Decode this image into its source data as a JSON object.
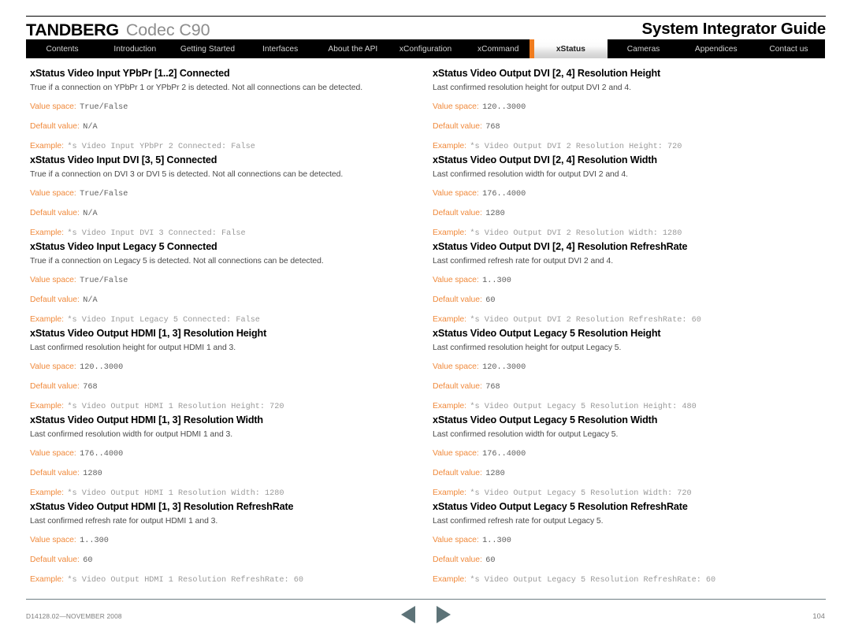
{
  "header": {
    "brand": "TANDBERG",
    "product": "Codec C90",
    "guide_title": "System Integrator Guide"
  },
  "nav": {
    "items": [
      {
        "label": "Contents",
        "active": false
      },
      {
        "label": "Introduction",
        "active": false
      },
      {
        "label": "Getting Started",
        "active": false
      },
      {
        "label": "Interfaces",
        "active": false
      },
      {
        "label": "About the API",
        "active": false
      },
      {
        "label": "xConfiguration",
        "active": false
      },
      {
        "label": "xCommand",
        "active": false
      },
      {
        "label": "xStatus",
        "active": true
      },
      {
        "label": "Cameras",
        "active": false
      },
      {
        "label": "Appendices",
        "active": false
      },
      {
        "label": "Contact us",
        "active": false
      }
    ],
    "active_accent_color": "#f07c1e"
  },
  "labels": {
    "value_space": "Value space:",
    "default_value": "Default value:",
    "example": "Example:"
  },
  "left_column": [
    {
      "title": "xStatus Video Input YPbPr [1..2] Connected",
      "description": "True if a connection on YPbPr 1 or YPbPr 2 is detected. Not all connections can be detected.",
      "value_space": "True/False",
      "default_value": "N/A",
      "example": "*s Video Input YPbPr 2 Connected: False"
    },
    {
      "title": "xStatus Video Input DVI [3, 5] Connected",
      "description": "True if a connection on DVI 3 or DVI 5 is detected. Not all connections can be detected.",
      "value_space": "True/False",
      "default_value": "N/A",
      "example": "*s Video Input DVI 3 Connected: False"
    },
    {
      "title": "xStatus Video Input Legacy 5 Connected",
      "description": "True if a connection on Legacy 5 is detected. Not all connections can be detected.",
      "value_space": "True/False",
      "default_value": "N/A",
      "example": "*s Video Input Legacy 5 Connected: False"
    },
    {
      "title": "xStatus Video Output HDMI [1, 3] Resolution Height",
      "description": "Last confirmed resolution height for output HDMI 1 and 3.",
      "value_space": "120..3000",
      "default_value": "768",
      "example": "*s Video Output HDMI 1 Resolution Height: 720"
    },
    {
      "title": "xStatus Video Output HDMI [1, 3] Resolution Width",
      "description": "Last confirmed resolution width for output HDMI 1 and 3.",
      "value_space": "176..4000",
      "default_value": "1280",
      "example": "*s Video Output HDMI 1 Resolution Width: 1280"
    },
    {
      "title": "xStatus Video Output HDMI [1, 3] Resolution RefreshRate",
      "description": "Last confirmed refresh rate for output HDMI 1 and 3.",
      "value_space": "1..300",
      "default_value": "60",
      "example": "*s Video Output HDMI 1 Resolution RefreshRate: 60"
    }
  ],
  "right_column": [
    {
      "title": "xStatus Video Output DVI [2, 4] Resolution Height",
      "description": "Last confirmed resolution height for output DVI 2 and 4.",
      "value_space": "120..3000",
      "default_value": "768",
      "example": "*s Video Output DVI 2 Resolution Height: 720"
    },
    {
      "title": "xStatus Video Output DVI [2, 4] Resolution Width",
      "description": "Last confirmed resolution width for output DVI 2 and 4.",
      "value_space": "176..4000",
      "default_value": "1280",
      "example": "*s Video Output DVI 2 Resolution Width: 1280"
    },
    {
      "title": "xStatus Video Output DVI [2, 4] Resolution RefreshRate",
      "description": "Last confirmed refresh rate for output DVI 2 and 4.",
      "value_space": "1..300",
      "default_value": "60",
      "example": "*s Video Output DVI 2 Resolution RefreshRate: 60"
    },
    {
      "title": "xStatus Video Output Legacy 5 Resolution Height",
      "description": "Last confirmed resolution height for output Legacy 5.",
      "value_space": "120..3000",
      "default_value": "768",
      "example": "*s Video Output Legacy 5 Resolution Height: 480"
    },
    {
      "title": "xStatus Video Output Legacy 5 Resolution Width",
      "description": "Last confirmed resolution width for output Legacy 5.",
      "value_space": "176..4000",
      "default_value": "1280",
      "example": "*s Video Output Legacy 5 Resolution Width: 720"
    },
    {
      "title": "xStatus Video Output Legacy 5 Resolution RefreshRate",
      "description": "Last confirmed refresh rate for output Legacy 5.",
      "value_space": "1..300",
      "default_value": "60",
      "example": "*s Video Output Legacy 5 Resolution RefreshRate: 60"
    }
  ],
  "footer": {
    "document_id": "D14128.02—NOVEMBER 2008",
    "page_number": "104",
    "prev_icon": "triangle-left-icon",
    "next_icon": "triangle-right-icon"
  }
}
